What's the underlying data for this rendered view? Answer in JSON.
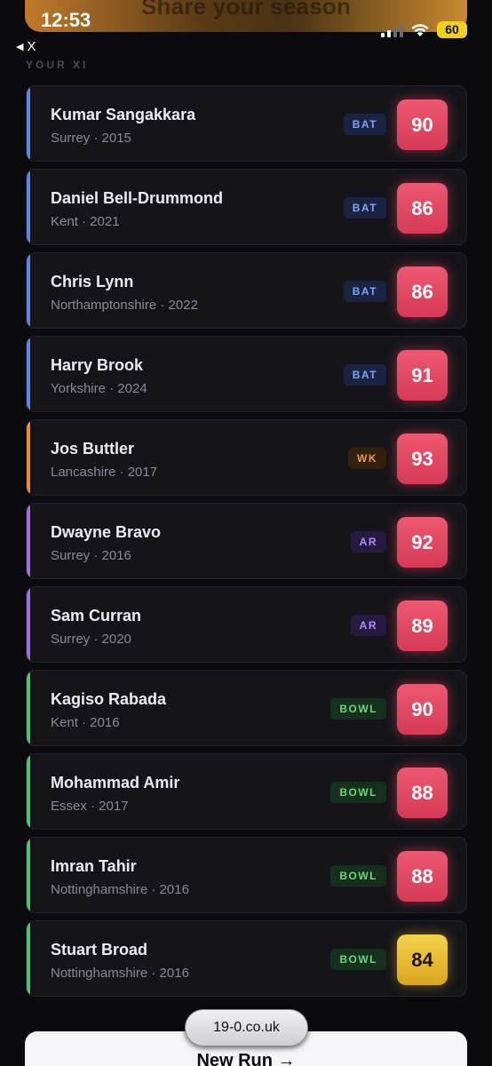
{
  "status_bar": {
    "time": "12:53",
    "battery": "60"
  },
  "banner": {
    "text": "Share your season"
  },
  "back": {
    "label": "X"
  },
  "section": {
    "label": "YOUR XI"
  },
  "players": [
    {
      "name": "Kumar Sangakkara",
      "meta": "Surrey · 2015",
      "role": "BAT",
      "rating": "90"
    },
    {
      "name": "Daniel Bell-Drummond",
      "meta": "Kent · 2021",
      "role": "BAT",
      "rating": "86"
    },
    {
      "name": "Chris Lynn",
      "meta": "Northamptonshire · 2022",
      "role": "BAT",
      "rating": "86"
    },
    {
      "name": "Harry Brook",
      "meta": "Yorkshire · 2024",
      "role": "BAT",
      "rating": "91"
    },
    {
      "name": "Jos Buttler",
      "meta": "Lancashire · 2017",
      "role": "WK",
      "rating": "93"
    },
    {
      "name": "Dwayne Bravo",
      "meta": "Surrey · 2016",
      "role": "AR",
      "rating": "92"
    },
    {
      "name": "Sam Curran",
      "meta": "Surrey · 2020",
      "role": "AR",
      "rating": "89"
    },
    {
      "name": "Kagiso Rabada",
      "meta": "Kent · 2016",
      "role": "BOWL",
      "rating": "90"
    },
    {
      "name": "Mohammad Amir",
      "meta": "Essex · 2017",
      "role": "BOWL",
      "rating": "88"
    },
    {
      "name": "Imran Tahir",
      "meta": "Nottinghamshire · 2016",
      "role": "BOWL",
      "rating": "88"
    },
    {
      "name": "Stuart Broad",
      "meta": "Nottinghamshire · 2016",
      "role": "BOWL",
      "rating": "84"
    }
  ],
  "footer": {
    "url": "19-0.co.uk",
    "new_run_label": "New Run →"
  },
  "colors": {
    "background": "#0b0b0f",
    "bat": "#5b87e8",
    "wk": "#e88c3a",
    "ar": "#a36de6",
    "bowl": "#4fc46a",
    "rating_red": "#e24a64",
    "rating_gold": "#e8bb30"
  }
}
